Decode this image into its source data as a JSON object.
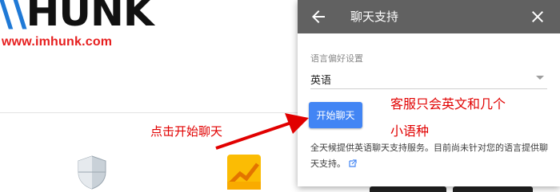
{
  "background": {
    "logo_text_dark": "HUNK",
    "logo_url": "www.imhunk.com"
  },
  "chat_panel": {
    "title": "聊天支持",
    "back_icon": "arrow-left-icon",
    "close_icon": "close-icon",
    "language_label": "语言偏好设置",
    "language_value": "英语",
    "start_button": "开始聊天",
    "support_text": "全天候提供英语聊天支持服务。目前尚未针对您的语言提供聊天支持。",
    "external_link_icon": "external-link-icon"
  },
  "annotations": {
    "right_line1": "客服只会英文和几个",
    "right_line2": "小语种",
    "left": "点击开始聊天",
    "color": "#e10000"
  },
  "colors": {
    "header": "#616161",
    "button": "#4285f4"
  }
}
